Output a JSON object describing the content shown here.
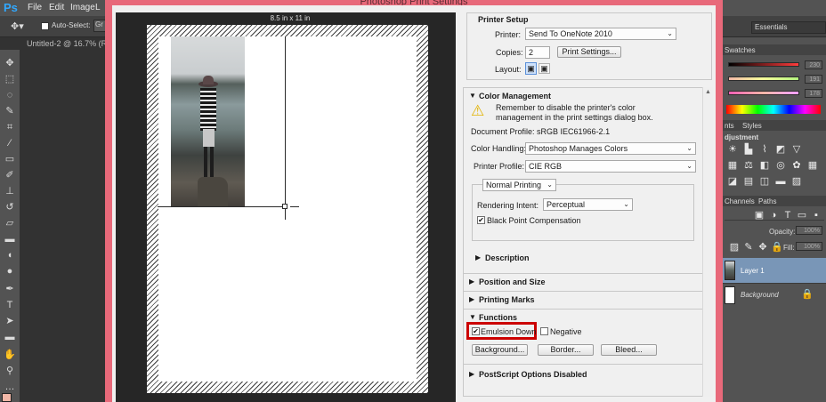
{
  "menubar": {
    "logo": "Ps",
    "items": [
      "File",
      "Edit",
      "Image",
      "L"
    ]
  },
  "options_bar": {
    "auto_select_label": "Auto-Select:",
    "auto_select_value": "Gr"
  },
  "document_tab": {
    "title": "Untitled-2 @ 16.7% (RGB"
  },
  "dialog": {
    "title": "Photoshop Print Settings",
    "paper_size_label": "8.5 in x 11 in",
    "printer_setup": {
      "heading": "Printer Setup",
      "printer_label": "Printer:",
      "printer_value": "Send To OneNote 2010",
      "copies_label": "Copies:",
      "copies_value": "2",
      "print_settings_button": "Print Settings...",
      "layout_label": "Layout:"
    },
    "color_management": {
      "heading": "Color Management",
      "warning_text": "Remember to disable the printer's color management in the print settings dialog box.",
      "document_profile": "Document Profile: sRGB IEC61966-2.1",
      "color_handling_label": "Color Handling:",
      "color_handling_value": "Photoshop Manages Colors",
      "printer_profile_label": "Printer Profile:",
      "printer_profile_value": "CIE RGB",
      "printing_mode": "Normal Printing",
      "rendering_intent_label": "Rendering Intent:",
      "rendering_intent_value": "Perceptual",
      "black_point_label": "Black Point Compensation",
      "black_point_checked": true
    },
    "sections": {
      "description": "Description",
      "position_and_size": "Position and Size",
      "printing_marks": "Printing Marks",
      "functions": "Functions",
      "postscript": "PostScript Options Disabled"
    },
    "functions": {
      "emulsion_down_label": "Emulsion Down",
      "emulsion_down_checked": true,
      "negative_label": "Negative",
      "negative_checked": false,
      "background_button": "Background...",
      "border_button": "Border...",
      "bleed_button": "Bleed..."
    }
  },
  "right_panel": {
    "workspace": "Essentials",
    "swatches_tab": "Swatches",
    "slider_values": [
      "230",
      "191",
      "178"
    ],
    "tabs": [
      "nts",
      "Styles"
    ],
    "adjustments_heading": "djustment",
    "layers_tabs": [
      "Channels",
      "Paths"
    ],
    "opacity_label": "Opacity:",
    "opacity_value": "100%",
    "fill_label": "Fill:",
    "fill_value": "100%",
    "layers": [
      {
        "name": "Layer 1"
      },
      {
        "name": "Background"
      }
    ]
  },
  "colors": {
    "dialog_frame": "#e8697a",
    "highlight_red": "#cc0000",
    "photoshop_blue": "#31a8ff",
    "foreground_swatch": "#f2b7a7"
  }
}
